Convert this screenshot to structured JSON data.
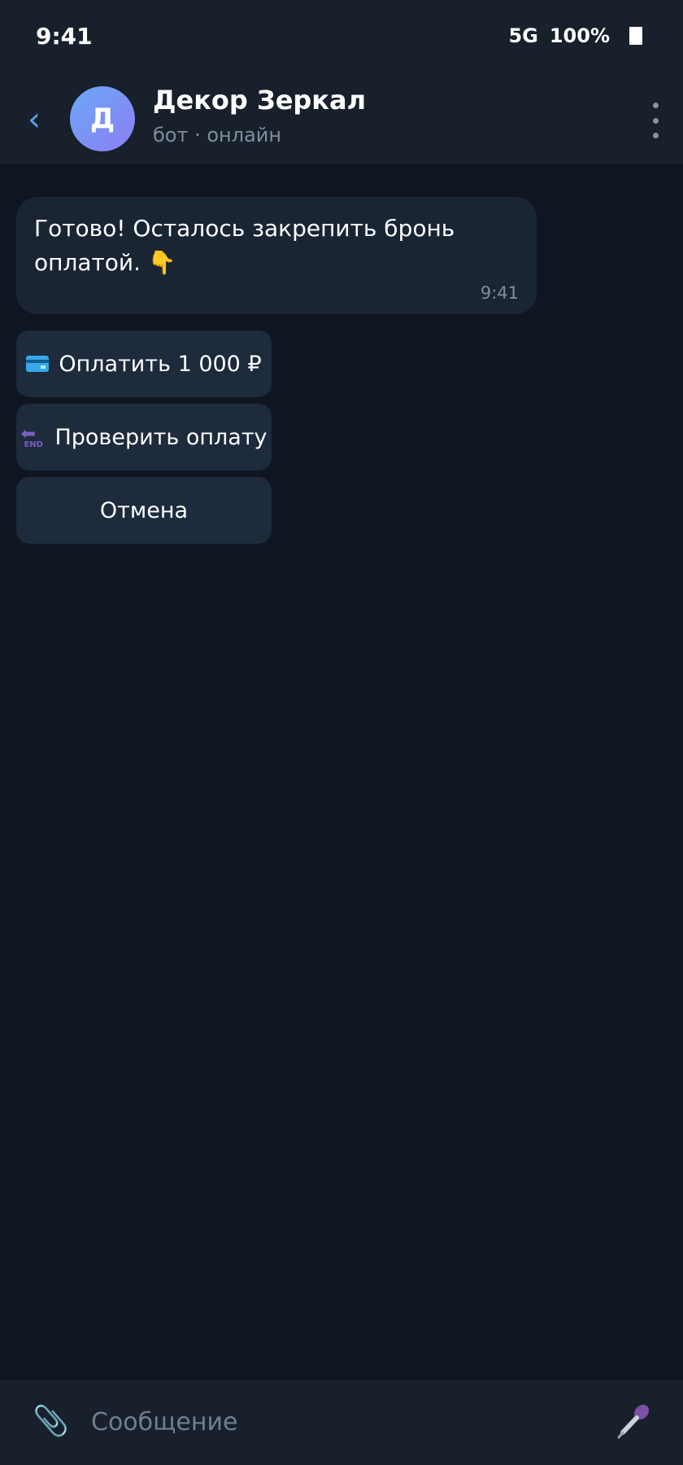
{
  "status_bar": {
    "time": "9:41",
    "network": "5G",
    "battery": "100%"
  },
  "header": {
    "back_icon": "chevron-left-icon",
    "avatar_letter": "Д",
    "title": "Декор Зеркал",
    "subtitle": "бот · онлайн",
    "menu_icon": "more-vertical-icon"
  },
  "message": {
    "text": "Готово! Осталось закрепить бронь оплатой. 👇",
    "time": "9:41"
  },
  "inline_buttons": {
    "pay": {
      "label": "Оплатить 1 000 ₽",
      "icon": "credit-card-icon"
    },
    "check": {
      "label": "Проверить оплату",
      "icon": "end-arrow-icon"
    },
    "cancel": {
      "label": "Отмена"
    }
  },
  "input_bar": {
    "placeholder": "Сообщение",
    "attach_icon": "paperclip-icon",
    "mic_icon": "microphone-icon"
  },
  "colors": {
    "background": "#0f1621",
    "header": "#17202b",
    "bubble": "#1a2534",
    "button": "#1d2b3c",
    "accent": "#5aa3e8"
  }
}
